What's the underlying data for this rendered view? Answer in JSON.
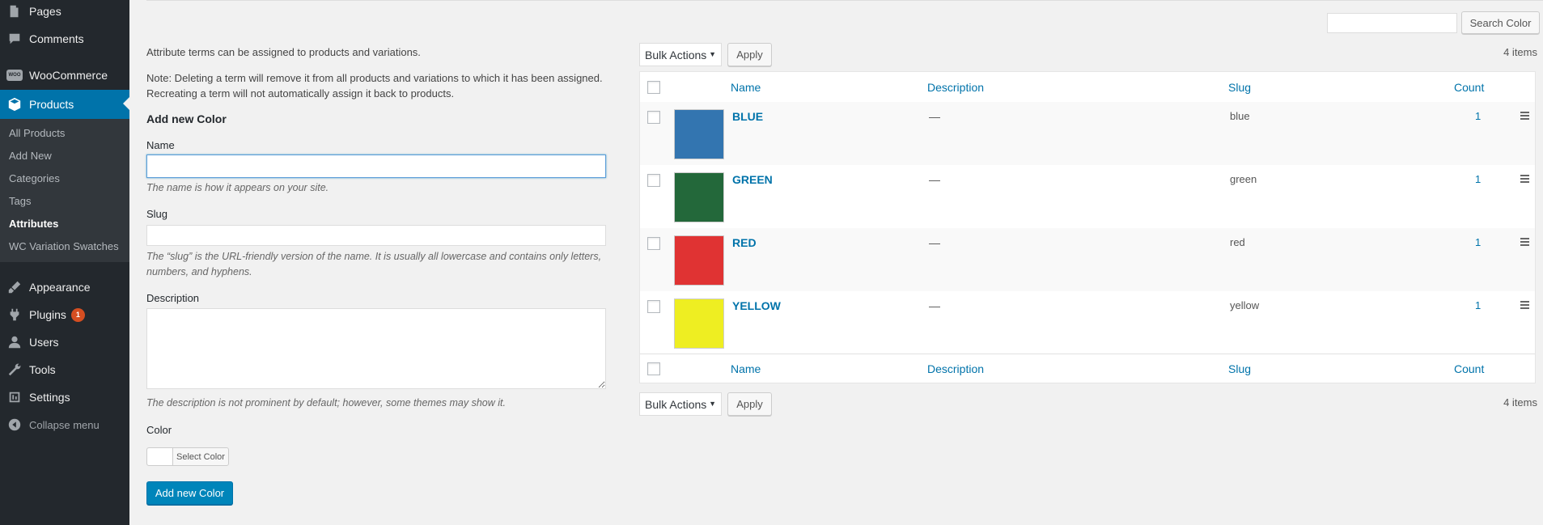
{
  "sidebar": {
    "top_items": [
      {
        "label": "Pages",
        "icon": "pages-icon"
      },
      {
        "label": "Comments",
        "icon": "comments-icon"
      },
      {
        "label": "WooCommerce",
        "icon": "woocommerce-icon"
      },
      {
        "label": "Products",
        "icon": "products-icon"
      }
    ],
    "woo_logo_text": "WOO",
    "submenu": [
      "All Products",
      "Add New",
      "Categories",
      "Tags",
      "Attributes",
      "WC Variation Swatches"
    ],
    "bottom_items": [
      {
        "label": "Appearance",
        "icon": "appearance-icon"
      },
      {
        "label": "Plugins",
        "icon": "plugins-icon",
        "badge": "1"
      },
      {
        "label": "Users",
        "icon": "users-icon"
      },
      {
        "label": "Tools",
        "icon": "tools-icon"
      },
      {
        "label": "Settings",
        "icon": "settings-icon"
      }
    ],
    "collapse": "Collapse menu"
  },
  "search": {
    "button": "Search Color",
    "value": ""
  },
  "form": {
    "intro": "Attribute terms can be assigned to products and variations.",
    "note_line1": "Note: Deleting a term will remove it from all products and variations to which it has been assigned.",
    "note_line2": "Recreating a term will not automatically assign it back to products.",
    "heading": "Add new Color",
    "name_label": "Name",
    "name_hint": "The name is how it appears on your site.",
    "slug_label": "Slug",
    "slug_hint_line1": "The “slug” is the URL-friendly version of the name. It is usually all lowercase and contains only letters,",
    "slug_hint_line2": "numbers, and hyphens.",
    "description_label": "Description",
    "description_hint": "The description is not prominent by default; however, some themes may show it.",
    "color_label": "Color",
    "select_color": "Select Color",
    "submit": "Add new Color"
  },
  "bulk": {
    "label": "Bulk Actions",
    "apply": "Apply",
    "items_count": "4 items"
  },
  "table": {
    "columns": {
      "name": "Name",
      "description": "Description",
      "slug": "Slug",
      "count": "Count"
    },
    "rows": [
      {
        "name": "BLUE",
        "description": "—",
        "slug": "blue",
        "count": "1",
        "color": "#3375b0"
      },
      {
        "name": "GREEN",
        "description": "—",
        "slug": "green",
        "count": "1",
        "color": "#23683a"
      },
      {
        "name": "RED",
        "description": "—",
        "slug": "red",
        "count": "1",
        "color": "#e03333"
      },
      {
        "name": "YELLOW",
        "description": "—",
        "slug": "yellow",
        "count": "1",
        "color": "#eeee22"
      }
    ]
  },
  "colors": {
    "accent": "#0073aa",
    "primary_button": "#0085ba",
    "sidebar": "#23282d",
    "badge": "#d54e21"
  }
}
